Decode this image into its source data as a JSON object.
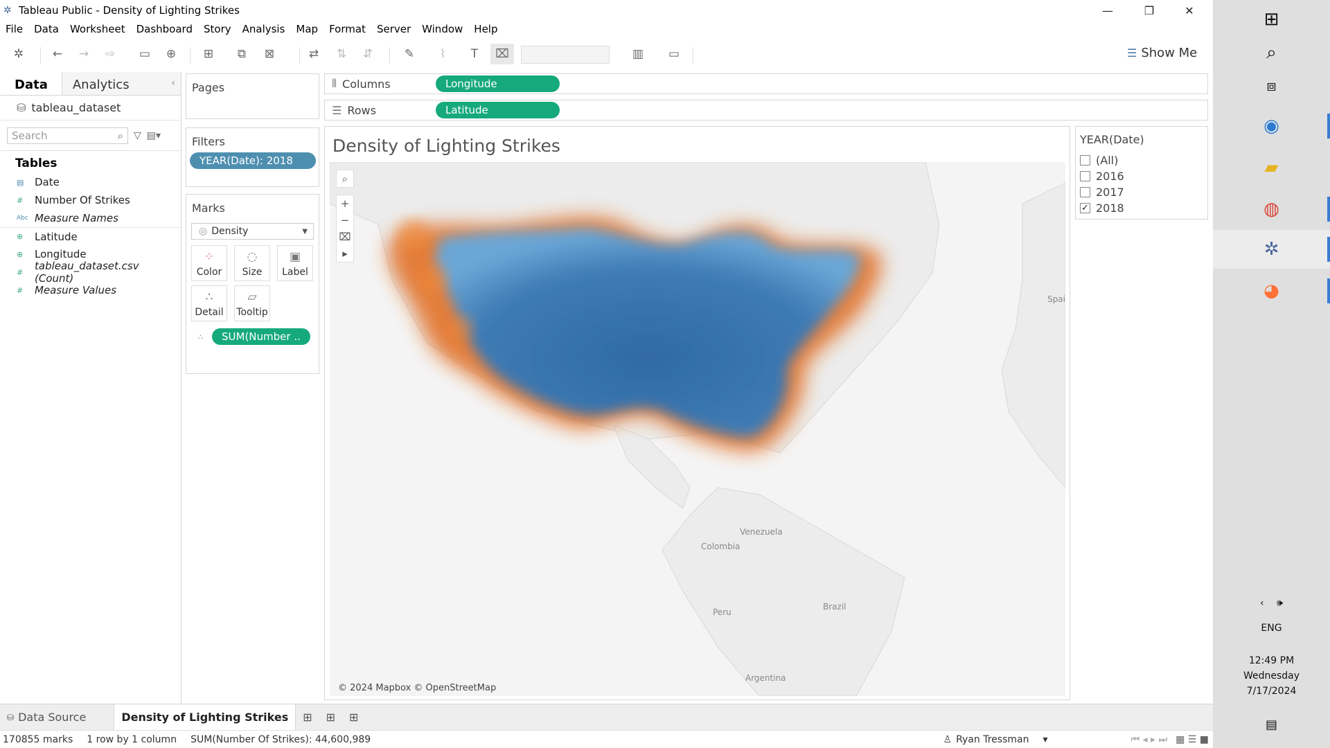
{
  "window": {
    "title": "Tableau Public - Density of Lighting Strikes",
    "controls": {
      "minimize": "—",
      "maximize": "❐",
      "close": "✕"
    }
  },
  "menu": [
    "File",
    "Data",
    "Worksheet",
    "Dashboard",
    "Story",
    "Analysis",
    "Map",
    "Format",
    "Server",
    "Window",
    "Help"
  ],
  "toolbar": {
    "show_me_label": "Show Me"
  },
  "data_pane": {
    "tab_data": "Data",
    "tab_analytics": "Analytics",
    "datasource": "tableau_dataset",
    "search_placeholder": "Search",
    "tables_heading": "Tables",
    "fields": [
      {
        "name": "Date",
        "type_icon": "▤",
        "style": "normal"
      },
      {
        "name": "Number Of Strikes",
        "type_icon": "#",
        "style": "normal"
      },
      {
        "name": "Measure Names",
        "type_icon": "Abc",
        "style": "italic"
      },
      {
        "name": "Latitude",
        "type_icon": "⊕",
        "style": "normal"
      },
      {
        "name": "Longitude",
        "type_icon": "⊕",
        "style": "normal"
      },
      {
        "name": "tableau_dataset.csv (Count)",
        "type_icon": "#",
        "style": "italic"
      },
      {
        "name": "Measure Values",
        "type_icon": "#",
        "style": "italic"
      }
    ]
  },
  "pages": {
    "title": "Pages"
  },
  "filters": {
    "title": "Filters",
    "pill": "YEAR(Date): 2018"
  },
  "marks": {
    "title": "Marks",
    "type": "Density",
    "buttons": [
      "Color",
      "Size",
      "Label",
      "Detail",
      "Tooltip"
    ],
    "measure_pill": "SUM(Number .."
  },
  "shelves": {
    "columns_label": "Columns",
    "columns_pill": "Longitude",
    "rows_label": "Rows",
    "rows_pill": "Latitude"
  },
  "viz": {
    "title": "Density of Lighting Strikes",
    "attribution": "© 2024 Mapbox © OpenStreetMap",
    "map_labels": {
      "spain": "Spain",
      "venezuela": "Venezuela",
      "colombia": "Colombia",
      "peru": "Peru",
      "brazil": "Brazil",
      "argentina": "Argentina"
    },
    "density_colors": {
      "core": "#2f6aa4",
      "mid": "#6aa6d6",
      "edge": "#e26a1f"
    }
  },
  "filter_card": {
    "title": "YEAR(Date)",
    "options": [
      {
        "label": "(All)",
        "checked": false
      },
      {
        "label": "2016",
        "checked": false
      },
      {
        "label": "2017",
        "checked": false
      },
      {
        "label": "2018",
        "checked": true
      }
    ]
  },
  "sheet_tabs": {
    "datasource": "Data Source",
    "active": "Density of Lighting Strikes"
  },
  "status": {
    "marks": "170855 marks",
    "rows_cols": "1 row by 1 column",
    "sum": "SUM(Number Of Strikes): 44,600,989",
    "user": "Ryan Tressman"
  },
  "taskbar": {
    "lang": "ENG",
    "time": "12:49 PM",
    "day": "Wednesday",
    "date": "7/17/2024"
  }
}
